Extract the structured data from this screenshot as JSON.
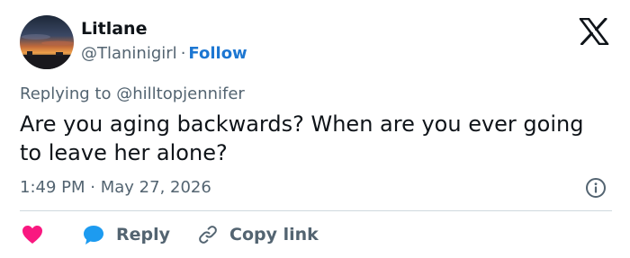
{
  "author": {
    "name": "Litlane",
    "handle": "@Tlaninigirl",
    "separator": "·",
    "follow_label": "Follow"
  },
  "replying": {
    "prefix": "Replying to",
    "handle": "@hilltopjennifer"
  },
  "tweet": {
    "text": "Are you aging backwards? When are you ever going to leave her alone?",
    "time": "1:49 PM",
    "separator": "·",
    "date": "May 27, 2026"
  },
  "actions": {
    "reply_label": "Reply",
    "copy_link_label": "Copy link"
  },
  "icons": {
    "brand": "x-logo-icon",
    "info": "info-icon",
    "like": "heart-icon",
    "reply": "speech-bubble-icon",
    "copy": "link-icon"
  },
  "colors": {
    "text_primary": "#0f1419",
    "text_secondary": "#536471",
    "follow": "#1d77d2",
    "heart": "#f91880",
    "reply_bubble": "#1d9bf0",
    "divider": "#cfd9de"
  }
}
